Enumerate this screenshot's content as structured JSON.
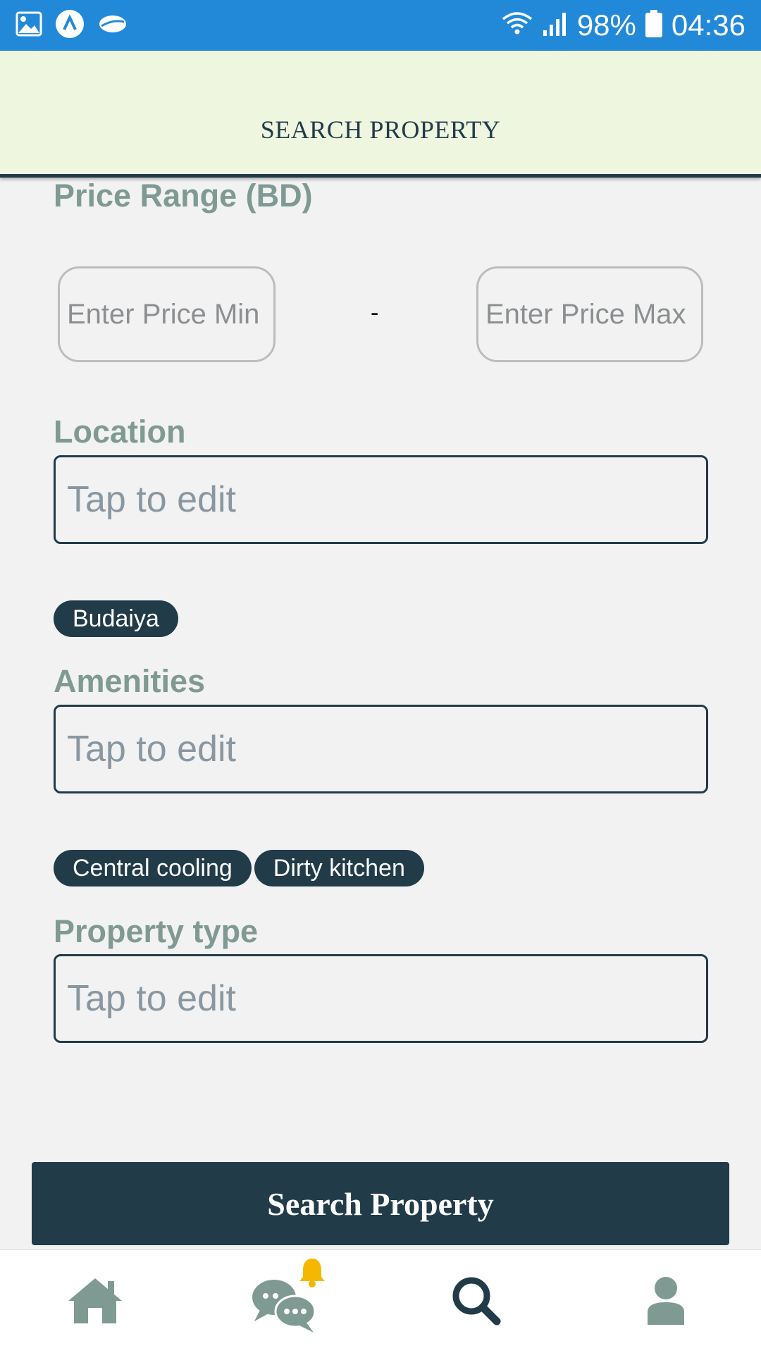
{
  "status_bar": {
    "battery": "98%",
    "time": "04:36"
  },
  "header": {
    "title": "SEARCH PROPERTY"
  },
  "form": {
    "price_label": "Price Range (BD)",
    "price_min_placeholder": "Enter Price Min",
    "price_separator": "-",
    "price_max_placeholder": "Enter Price Max",
    "location_label": "Location",
    "location_placeholder": "Tap to edit",
    "location_chips": [
      "Budaiya"
    ],
    "amenities_label": "Amenities",
    "amenities_placeholder": "Tap to edit",
    "amenities_chips": [
      "Central cooling",
      "Dirty kitchen"
    ],
    "property_type_label": "Property type",
    "property_type_placeholder": "Tap to edit"
  },
  "search_button_label": "Search Property",
  "bottom_nav": {
    "items": [
      {
        "icon": "home-icon"
      },
      {
        "icon": "chat-icon",
        "badge_icon": "bell-icon"
      },
      {
        "icon": "search-icon"
      },
      {
        "icon": "profile-icon"
      }
    ]
  },
  "colors": {
    "status_bar": "#2289d9",
    "header_bg": "#eff6e0",
    "primary": "#213b48",
    "label": "#7f9a92",
    "icon_muted": "#7f9a92",
    "bell": "#f5b800"
  }
}
